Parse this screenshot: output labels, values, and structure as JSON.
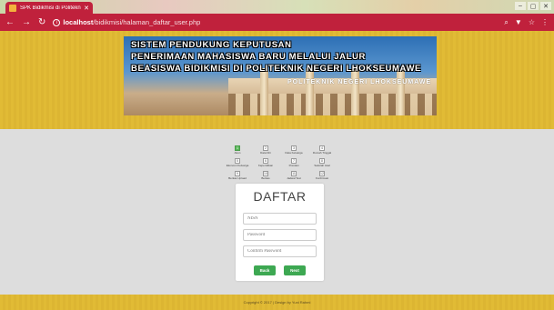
{
  "browser": {
    "tab_title": "SPK Bidikmisi di Politekn",
    "url_host": "localhost",
    "url_path": "/bidikmisi/halaman_daftar_user.php"
  },
  "banner": {
    "line1": "SISTEM PENDUKUNG KEPUTUSAN",
    "line2": "PENERIMAAN MAHASISWA BARU MELALUI JALUR",
    "line3": "BEASISWA BIDIKMISI DI POLITEKNIK NEGERI LHOKSEUMAWE",
    "sign": "POLITEKNIK NEGERI LHOKSEUMAWE"
  },
  "stepper": {
    "steps": [
      {
        "num": "1",
        "label": "Akun"
      },
      {
        "num": "2",
        "label": "Data Diri"
      },
      {
        "num": "3",
        "label": "Data Keluarga"
      },
      {
        "num": "4",
        "label": "Rumah Tinggal"
      },
      {
        "num": "5",
        "label": "Ekonomi Keluarga"
      },
      {
        "num": "6",
        "label": "Kepemilikan"
      },
      {
        "num": "7",
        "label": "Prestasi"
      },
      {
        "num": "8",
        "label": "Sekolah Asal"
      },
      {
        "num": "9",
        "label": "Berkas Upload"
      },
      {
        "num": "10",
        "label": "Berkas"
      },
      {
        "num": "11",
        "label": "Jadwal Test"
      },
      {
        "num": "12",
        "label": "Konfirmasi"
      }
    ]
  },
  "form": {
    "title": "DAFTAR",
    "nisn_placeholder": "NISN",
    "password_placeholder": "Password",
    "confirm_placeholder": "Confirm Password",
    "back_label": "Back",
    "next_label": "Next"
  },
  "footer": {
    "text": "Copyright © 2017 | Design by Yuni Rahmi"
  }
}
